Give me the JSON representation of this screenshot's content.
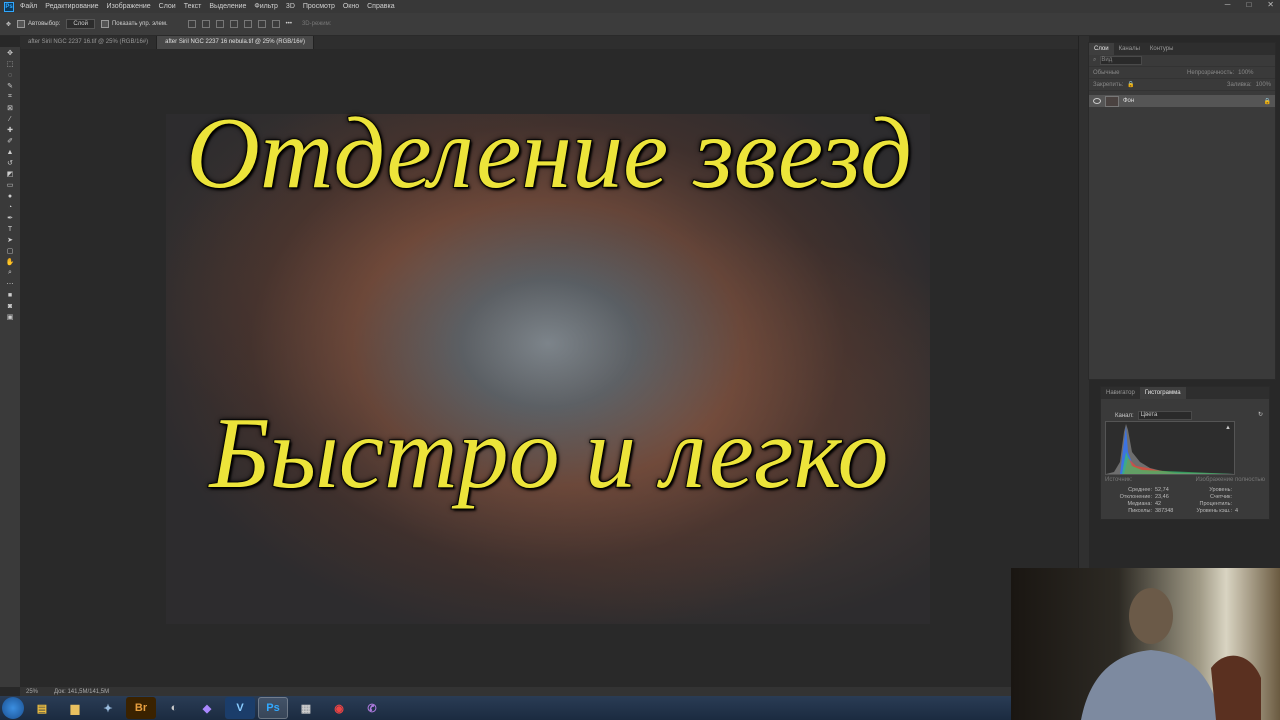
{
  "menu": [
    "Файл",
    "Редактирование",
    "Изображение",
    "Слои",
    "Текст",
    "Выделение",
    "Фильтр",
    "3D",
    "Просмотр",
    "Окно",
    "Справка"
  ],
  "app_logo": "Ps",
  "options": {
    "autoselect_label": "Автовыбор:",
    "autoselect_value": "Слой",
    "show_controls_label": "Показать упр. элем.",
    "mode3d_label": "3D-режим:"
  },
  "tabs": [
    "after Siril NGC 2237 16.tif @ 25% (RGB/16#)",
    "after Siril NGC 2237 16 nebula.tif @ 25% (RGB/16#)"
  ],
  "overlay": {
    "line1": "Отделение звезд",
    "line2": "Быстро и легко"
  },
  "status": {
    "zoom": "25%",
    "doc": "Док: 141,5M/141,5M"
  },
  "layers_panel": {
    "tabs": [
      "Слои",
      "Каналы",
      "Контуры"
    ],
    "kind": "Вид",
    "blend": "Обычные",
    "opacity_label": "Непрозрачность:",
    "opacity_value": "100%",
    "lock_label": "Закрепить:",
    "fill_label": "Заливка:",
    "fill_value": "100%",
    "layer_name": "Фон"
  },
  "histogram_panel": {
    "tabs": [
      "Навигатор",
      "Гистограмма"
    ],
    "channel_label": "Канал:",
    "channel_value": "Цвета",
    "source_left": "Источник:",
    "source_right": "Изображение полностью",
    "stats": [
      {
        "label": "Среднее:",
        "value": "52,74",
        "label2": "Уровень:",
        "value2": ""
      },
      {
        "label": "Отклонение:",
        "value": "23,46",
        "label2": "Счетчик:",
        "value2": ""
      },
      {
        "label": "Медиана:",
        "value": "42",
        "label2": "Процентиль:",
        "value2": ""
      },
      {
        "label": "Пикселы:",
        "value": "387348",
        "label2": "Уровень кэш.:",
        "value2": "4"
      }
    ]
  },
  "taskbar": [
    "",
    "",
    "",
    "Br",
    "",
    "",
    "V",
    "Ps",
    "",
    "",
    "",
    ""
  ],
  "window_controls": [
    "─",
    "□",
    "✕"
  ]
}
